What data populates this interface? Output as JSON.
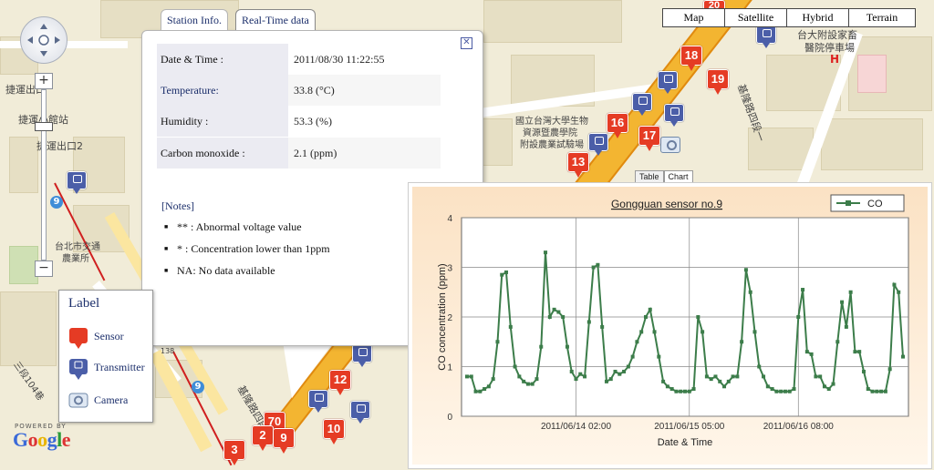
{
  "map_types": [
    "Map",
    "Satellite",
    "Hybrid",
    "Terrain"
  ],
  "map_labels": {
    "station_left": "捷運出口",
    "station_name": "捷運小館站",
    "station_exit2": "捷運出口2",
    "campus_1": "國立台灣大學生物",
    "campus_2": "資源暨農學院",
    "campus_3": "附設農業試驗場",
    "hospital_1": "台大附設家畜",
    "hospital_2": "醫院停車場",
    "hospital_mark": "H",
    "road_vertical": "基隆路四段一",
    "market_1": "台北市交通",
    "market_2": "農業所",
    "lane": "三段104巷",
    "road_bottom": "基隆路四段",
    "route_9": "9",
    "street_no": "138"
  },
  "sensor_pins": [
    "20",
    "18",
    "19",
    "16",
    "17",
    "13",
    "12",
    "70",
    "2",
    "9",
    "10",
    "3"
  ],
  "info_window": {
    "tabs": [
      "Station Info.",
      "Real-Time data"
    ],
    "rows": [
      {
        "label": "Date & Time :",
        "value": "2011/08/30 11:22:55"
      },
      {
        "label": "Temperature:",
        "value": "33.8 (°C)"
      },
      {
        "label": "Humidity :",
        "value": "53.3 (%)"
      },
      {
        "label": "Carbon monoxide :",
        "value": "2.1 (ppm)"
      }
    ],
    "notes_title": "[Notes]",
    "notes": [
      "** : Abnormal voltage value",
      "* : Concentration lower than 1ppm",
      "NA: No data available"
    ]
  },
  "legend": {
    "title": "Label",
    "items": [
      "Sensor",
      "Transmitter",
      "Camera"
    ]
  },
  "google": {
    "powered": "POWERED BY",
    "logo": "Google"
  },
  "chart_tabs": [
    "Table",
    "Chart"
  ],
  "chart_data": {
    "type": "line",
    "title": "Gongguan sensor no.9",
    "xlabel": "Date & Time",
    "ylabel": "CO concentration (ppm)",
    "ylim": [
      0,
      4
    ],
    "yticks": [
      0,
      1,
      2,
      3,
      4
    ],
    "xticks": [
      "2011/06/14 02:00",
      "2011/06/15 05:00",
      "2011/06/16 08:00"
    ],
    "grid": true,
    "legend": "top-right",
    "series": [
      {
        "name": "CO",
        "color": "#3c7d4a",
        "values": [
          0.8,
          0.8,
          0.5,
          0.5,
          0.55,
          0.6,
          0.75,
          1.5,
          2.85,
          2.9,
          1.8,
          1.0,
          0.8,
          0.7,
          0.65,
          0.65,
          0.75,
          1.4,
          3.3,
          2.0,
          2.15,
          2.1,
          2.0,
          1.4,
          0.9,
          0.75,
          0.85,
          0.8,
          1.9,
          3.0,
          3.05,
          1.8,
          0.7,
          0.75,
          0.9,
          0.85,
          0.9,
          1.0,
          1.2,
          1.5,
          1.7,
          2.0,
          2.15,
          1.7,
          1.2,
          0.7,
          0.6,
          0.55,
          0.5,
          0.5,
          0.5,
          0.5,
          0.55,
          2.0,
          1.7,
          0.8,
          0.75,
          0.8,
          0.7,
          0.6,
          0.7,
          0.8,
          0.8,
          1.5,
          2.95,
          2.5,
          1.7,
          1.0,
          0.8,
          0.6,
          0.55,
          0.5,
          0.5,
          0.5,
          0.5,
          0.55,
          2.0,
          2.55,
          1.3,
          1.25,
          0.8,
          0.8,
          0.6,
          0.55,
          0.65,
          1.5,
          2.3,
          1.8,
          2.5,
          1.3,
          1.3,
          0.9,
          0.55,
          0.5,
          0.5,
          0.5,
          0.5,
          0.95,
          2.65,
          2.5,
          1.2
        ]
      }
    ]
  }
}
